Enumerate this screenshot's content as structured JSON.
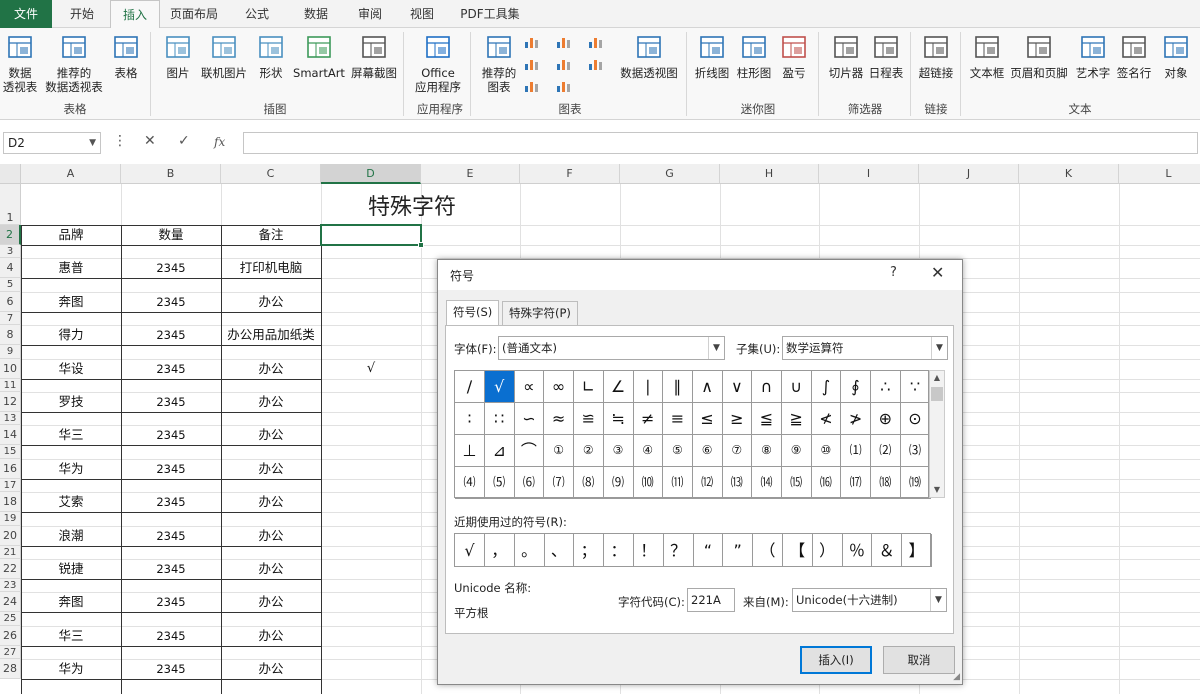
{
  "tabs": [
    "文件",
    "开始",
    "插入",
    "页面布局",
    "公式",
    "数据",
    "审阅",
    "视图",
    "PDF工具集"
  ],
  "active_tab": "插入",
  "ribbon": {
    "buttons": [
      {
        "id": "pivot",
        "label": "数据\n透视表",
        "icon": "pivot-table-icon"
      },
      {
        "id": "rec-pivot",
        "label": "推荐的\n数据透视表",
        "icon": "recommended-pivot-icon"
      },
      {
        "id": "table",
        "label": "表格",
        "icon": "table-icon"
      },
      {
        "id": "picture",
        "label": "图片",
        "icon": "picture-icon"
      },
      {
        "id": "online-picture",
        "label": "联机图片",
        "icon": "online-picture-icon"
      },
      {
        "id": "shapes",
        "label": "形状",
        "icon": "shapes-icon"
      },
      {
        "id": "smartart",
        "label": "SmartArt",
        "icon": "smartart-icon"
      },
      {
        "id": "screenshot",
        "label": "屏幕截图",
        "icon": "screenshot-icon"
      },
      {
        "id": "office-apps",
        "label": "Office\n应用程序",
        "icon": "office-apps-icon"
      },
      {
        "id": "rec-charts",
        "label": "推荐的\n图表",
        "icon": "recommended-charts-icon"
      },
      {
        "id": "pivot-chart",
        "label": "数据透视图",
        "icon": "pivot-chart-icon"
      },
      {
        "id": "line-spark",
        "label": "折线图",
        "icon": "line-sparkline-icon"
      },
      {
        "id": "col-spark",
        "label": "柱形图",
        "icon": "column-sparkline-icon"
      },
      {
        "id": "winloss",
        "label": "盈亏",
        "icon": "winloss-icon"
      },
      {
        "id": "slicer",
        "label": "切片器",
        "icon": "slicer-icon"
      },
      {
        "id": "timeline",
        "label": "日程表",
        "icon": "timeline-icon"
      },
      {
        "id": "hyperlink",
        "label": "超链接",
        "icon": "hyperlink-icon"
      },
      {
        "id": "textbox",
        "label": "文本框",
        "icon": "textbox-icon"
      },
      {
        "id": "header-footer",
        "label": "页眉和页脚",
        "icon": "header-footer-icon"
      },
      {
        "id": "wordart",
        "label": "艺术字",
        "icon": "wordart-icon"
      },
      {
        "id": "signature",
        "label": "签名行",
        "icon": "signature-icon"
      },
      {
        "id": "object",
        "label": "对象",
        "icon": "object-icon"
      }
    ],
    "groups": [
      "表格",
      "插图",
      "应用程序",
      "图表",
      "迷你图",
      "筛选器",
      "链接",
      "文本"
    ]
  },
  "formula_bar": {
    "name_box": "D2",
    "formula": ""
  },
  "columns": [
    "A",
    "B",
    "C",
    "D",
    "E",
    "F",
    "G",
    "H",
    "I",
    "J",
    "K",
    "L"
  ],
  "selected_column": "D",
  "selected_row": 2,
  "sheet": {
    "title": "特殊字符",
    "headers": [
      "品牌",
      "数量",
      "备注"
    ],
    "rows": [
      {
        "row": 4,
        "brand": "惠普",
        "qty": "2345",
        "note": "打印机电脑"
      },
      {
        "row": 6,
        "brand": "奔图",
        "qty": "2345",
        "note": "办公"
      },
      {
        "row": 8,
        "brand": "得力",
        "qty": "2345",
        "note": "办公用品加纸类"
      },
      {
        "row": 10,
        "brand": "华设",
        "qty": "2345",
        "note": "办公"
      },
      {
        "row": 12,
        "brand": "罗技",
        "qty": "2345",
        "note": "办公"
      },
      {
        "row": 14,
        "brand": "华三",
        "qty": "2345",
        "note": "办公"
      },
      {
        "row": 16,
        "brand": "华为",
        "qty": "2345",
        "note": "办公"
      },
      {
        "row": 18,
        "brand": "艾索",
        "qty": "2345",
        "note": "办公"
      },
      {
        "row": 20,
        "brand": "浪潮",
        "qty": "2345",
        "note": "办公"
      },
      {
        "row": 22,
        "brand": "锐捷",
        "qty": "2345",
        "note": "办公"
      },
      {
        "row": 24,
        "brand": "奔图",
        "qty": "2345",
        "note": "办公"
      },
      {
        "row": 26,
        "brand": "华三",
        "qty": "2345",
        "note": "办公"
      },
      {
        "row": 28,
        "brand": "华为",
        "qty": "2345",
        "note": "办公"
      }
    ],
    "d10_value": "√"
  },
  "dialog": {
    "title": "符号",
    "help": "?",
    "close": "✕",
    "tabs": [
      "符号(S)",
      "特殊字符(P)"
    ],
    "font_label": "字体(F):",
    "font_value": "(普通文本)",
    "subset_label": "子集(U):",
    "subset_value": "数学运算符",
    "symbols": [
      [
        "∕",
        "√",
        "∝",
        "∞",
        "∟",
        "∠",
        "∣",
        "∥",
        "∧",
        "∨",
        "∩",
        "∪",
        "∫",
        "∮",
        "∴",
        "∵"
      ],
      [
        "∶",
        "∷",
        "∽",
        "≈",
        "≌",
        "≒",
        "≠",
        "≡",
        "≤",
        "≥",
        "≦",
        "≧",
        "≮",
        "≯",
        "⊕",
        "⊙"
      ],
      [
        "⊥",
        "⊿",
        "⌒",
        "①",
        "②",
        "③",
        "④",
        "⑤",
        "⑥",
        "⑦",
        "⑧",
        "⑨",
        "⑩",
        "⑴",
        "⑵",
        "⑶"
      ],
      [
        "⑷",
        "⑸",
        "⑹",
        "⑺",
        "⑻",
        "⑼",
        "⑽",
        "⑾",
        "⑿",
        "⒀",
        "⒁",
        "⒂",
        "⒃",
        "⒄",
        "⒅",
        "⒆"
      ]
    ],
    "selected_symbol": "√",
    "recent_label": "近期使用过的符号(R):",
    "recent": [
      "√",
      "，",
      "。",
      "、",
      "；",
      "：",
      "！",
      "？",
      "“",
      "”",
      "（",
      "【",
      "）",
      "％",
      "＆",
      "】"
    ],
    "unicode_name_label": "Unicode 名称:",
    "unicode_name": "平方根",
    "char_code_label": "字符代码(C):",
    "char_code": "221A",
    "from_label": "来自(M):",
    "from_value": "Unicode(十六进制)",
    "insert_button": "插入(I)",
    "cancel_button": "取消"
  },
  "colors": {
    "accent": "#217346",
    "selection": "#0a6fd0"
  }
}
